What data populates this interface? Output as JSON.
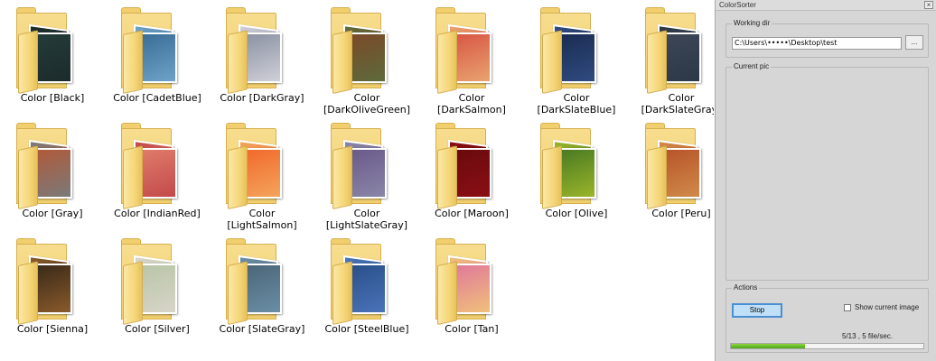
{
  "window": {
    "title": "ColorSorter",
    "close_glyph": "×"
  },
  "folders": [
    {
      "label": "Color [Black]",
      "thumbs": [
        "#1c2a2a",
        "#243c3a"
      ]
    },
    {
      "label": "Color [CadetBlue]",
      "thumbs": [
        "#6fa2c8",
        "#3b6e96"
      ]
    },
    {
      "label": "Color [DarkGray]",
      "thumbs": [
        "#cfcfd8",
        "#8c93a4"
      ]
    },
    {
      "label": "Color\n[DarkOliveGreen]",
      "thumbs": [
        "#5d6a3a",
        "#7b4a2a"
      ]
    },
    {
      "label": "Color\n[DarkSalmon]",
      "thumbs": [
        "#e8a36f",
        "#d95745"
      ]
    },
    {
      "label": "Color\n[DarkSlateBlue]",
      "thumbs": [
        "#2f4b80",
        "#1b2c52"
      ]
    },
    {
      "label": "Color\n[DarkSlateGray]",
      "thumbs": [
        "#2c3747",
        "#3c4656"
      ]
    },
    {
      "label": "Color [Gray]",
      "thumbs": [
        "#7a7a7a",
        "#b05a3a"
      ]
    },
    {
      "label": "Color [IndianRed]",
      "thumbs": [
        "#c24a4a",
        "#e07b6a"
      ]
    },
    {
      "label": "Color\n[LightSalmon]",
      "thumbs": [
        "#f3a45c",
        "#f26a2b"
      ]
    },
    {
      "label": "Color\n[LightSlateGray]",
      "thumbs": [
        "#8a86a8",
        "#6a5a8a"
      ]
    },
    {
      "label": "Color [Maroon]",
      "thumbs": [
        "#8a0f14",
        "#6a0a0e"
      ]
    },
    {
      "label": "Color [Olive]",
      "thumbs": [
        "#9ab52a",
        "#4a7a22"
      ]
    },
    {
      "label": "Color [Peru]",
      "thumbs": [
        "#d08a4a",
        "#b8552a"
      ]
    },
    {
      "label": "Color [Sienna]",
      "thumbs": [
        "#8a5a2a",
        "#3a2a1a"
      ]
    },
    {
      "label": "Color [Silver]",
      "thumbs": [
        "#d8d4c8",
        "#b9c6a8"
      ]
    },
    {
      "label": "Color [SlateGray]",
      "thumbs": [
        "#6a8ea6",
        "#4c6678"
      ]
    },
    {
      "label": "Color [SteelBlue]",
      "thumbs": [
        "#4a74b8",
        "#2a4f8a"
      ]
    },
    {
      "label": "Color [Tan]",
      "thumbs": [
        "#f0c07a",
        "#e07a9a"
      ]
    }
  ],
  "working_dir": {
    "legend": "Working dir",
    "value": "C:\\Users\\•••••\\Desktop\\test",
    "browse_label": "..."
  },
  "current_pic": {
    "legend": "Current pic"
  },
  "actions": {
    "legend": "Actions",
    "stop_label": "Stop",
    "show_current_label": "Show current image",
    "show_current_checked": false,
    "status_text": "5/13 , 5 file/sec.",
    "progress_fraction": 0.385
  },
  "colors": {
    "accent": "#4a8fd1",
    "progress": "#4aa51a",
    "folder": "#f1cf6e"
  }
}
